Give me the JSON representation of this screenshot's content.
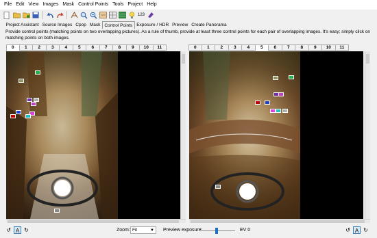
{
  "menu": [
    "File",
    "Edit",
    "View",
    "Images",
    "Mask",
    "Control Points",
    "Tools",
    "Project",
    "Help"
  ],
  "toolbar": {
    "icons": [
      "new-icon",
      "open-icon",
      "open-recent-icon",
      "save-icon",
      "undo-icon",
      "redo-icon",
      "fov-icon",
      "zoom-in-icon",
      "zoom-out-icon",
      "fit-icon",
      "optimize-icon",
      "preview-icon",
      "grid-icon",
      "hint-icon"
    ],
    "counter_label": "123"
  },
  "tabs": [
    "Project Assistant",
    "Source Images",
    "Cpop",
    "Mask",
    "Control Points",
    "Exposure / HDR",
    "Preview",
    "Create Panorama"
  ],
  "active_tab": "Control Points",
  "description": "Provide control points (matching points on two overlapping pictures). As a rule of thumb, provide at least three control points for each pair of overlapping images. It's easy; simply click on matching points on both images.",
  "left_image_tabs": [
    "0",
    "1",
    "2",
    "3",
    "4",
    "5",
    "6",
    "7",
    "8",
    "9",
    "10",
    "11"
  ],
  "left_active": "0",
  "right_image_tabs": [
    "0",
    "1",
    "2",
    "3",
    "4",
    "5",
    "6",
    "7",
    "8",
    "9",
    "10",
    "11"
  ],
  "right_active": "5",
  "bottom": {
    "zoom_label": "Zoom:",
    "zoom_value": "Fit",
    "preview_exposure_label": "Preview exposure:",
    "ev_value": "EV 0",
    "preview_exposure_fraction": 0.5,
    "rotate_left_icon": "rotate-ccw-icon",
    "auto_label": "A",
    "rotate_right_icon": "rotate-cw-icon"
  },
  "colors": {
    "cp_green": "#22b14c",
    "cp_purple": "#7030a0",
    "cp_red": "#c00000",
    "cp_magenta": "#e040e0",
    "cp_blue": "#2040c0",
    "cp_cyan": "#20c0c0",
    "cp_white": "#e0e0e0",
    "accent": "#1e6fbf"
  }
}
